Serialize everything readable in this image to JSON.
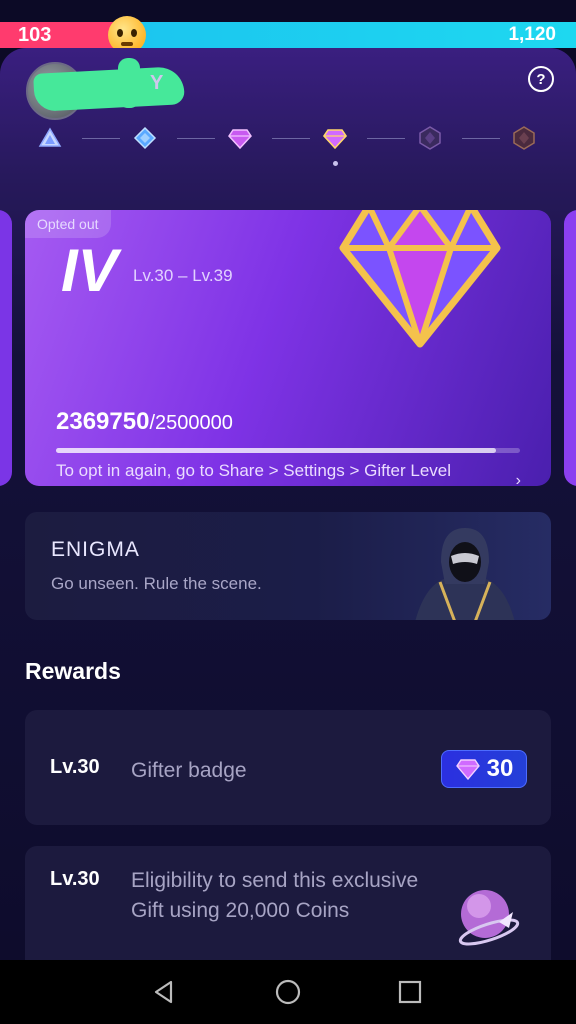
{
  "battle": {
    "left_score": "103",
    "right_score": "1,120",
    "emoji": "pleading-face-icon",
    "left_color": "#ff3b6e",
    "right_color": "#1ed8f0"
  },
  "header": {
    "username_visible": "Y",
    "help_icon": "?"
  },
  "tiers": [
    "tier-1-icon",
    "tier-2-icon",
    "tier-3-icon",
    "tier-4-icon",
    "tier-5-icon",
    "tier-6-icon"
  ],
  "level_card": {
    "status": "Opted out",
    "roman": "IV",
    "range": "Lv.30 – Lv.39",
    "current": "2369750",
    "total": "/2500000",
    "progress": 0.948,
    "note": "To opt in again, go to Share > Settings > Gifter Level Up Program",
    "arrow": "›"
  },
  "enigma": {
    "title": "ENIGMA",
    "subtitle": "Go unseen. Rule the scene."
  },
  "rewards": {
    "title": "Rewards",
    "items": [
      {
        "level": "Lv.30",
        "desc": "Gifter badge",
        "badge_value": "30"
      },
      {
        "level": "Lv.30",
        "desc": "Eligibility to send this exclusive Gift using 20,000 Coins"
      }
    ]
  },
  "nav": {
    "back": "back-icon",
    "home": "home-icon",
    "recents": "recents-icon"
  }
}
